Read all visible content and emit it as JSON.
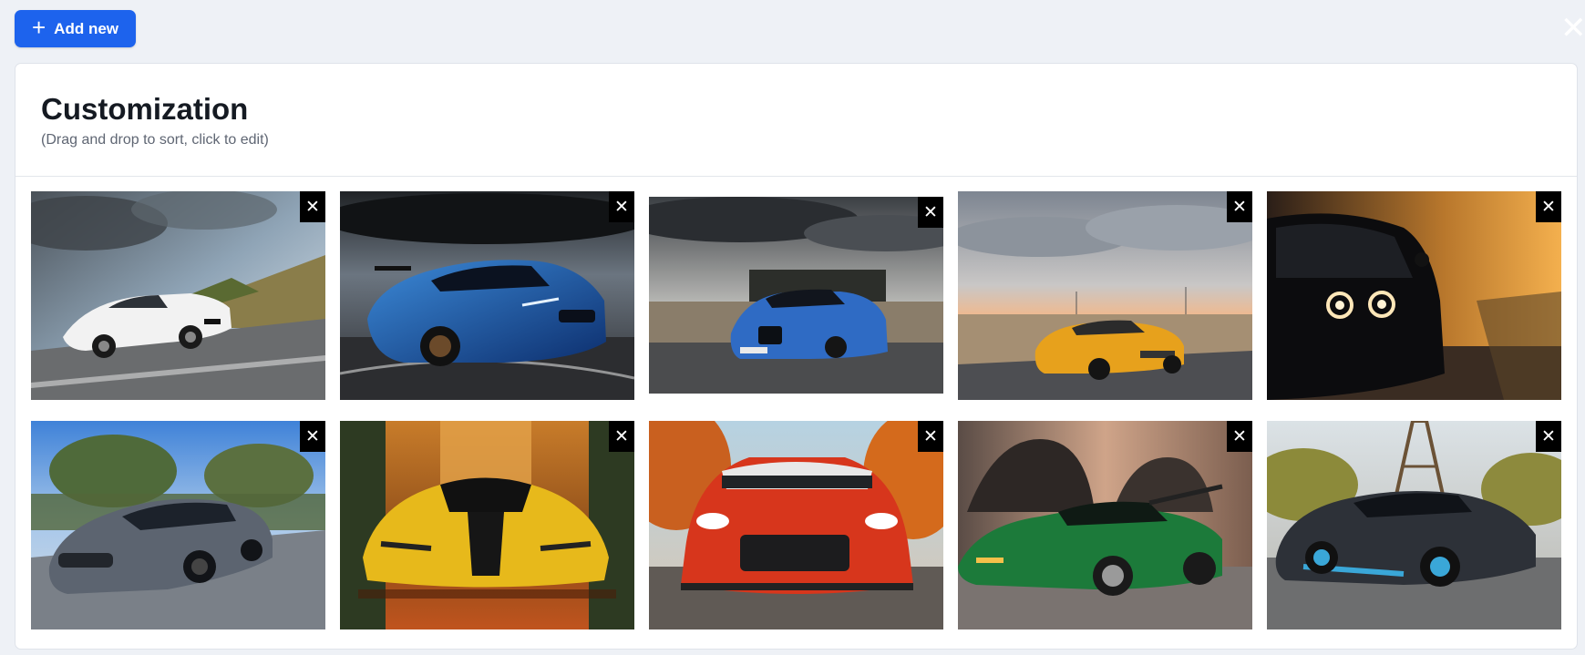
{
  "toolbar": {
    "add_label": "Add new",
    "add_icon": "plus-icon"
  },
  "window": {
    "close_glyph": "✕"
  },
  "card": {
    "title": "Customization",
    "subtitle": "(Drag and drop to sort, click to edit)"
  },
  "delete_glyph": "✕",
  "accent_color": "#1d63ed",
  "images": [
    {
      "subject": "white-sports-car"
    },
    {
      "subject": "blue-tuned-coupe"
    },
    {
      "subject": "blue-coupe-road"
    },
    {
      "subject": "yellow-supercar-desert"
    },
    {
      "subject": "black-muscle-car-sunset"
    },
    {
      "subject": "grey-electric-sedan"
    },
    {
      "subject": "yellow-black-hypercar"
    },
    {
      "subject": "red-coupe-autumn"
    },
    {
      "subject": "green-supercar-tunnel"
    },
    {
      "subject": "dark-hypercar-tower"
    }
  ]
}
